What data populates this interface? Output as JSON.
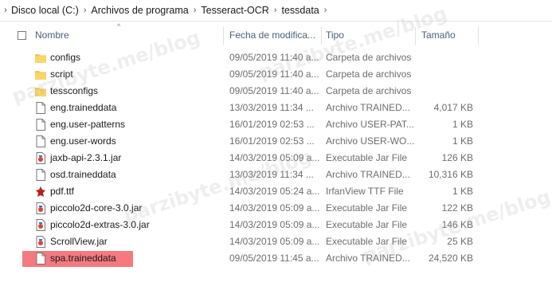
{
  "breadcrumb": {
    "items": [
      "Disco local (C:)",
      "Archivos de programa",
      "Tesseract-OCR",
      "tessdata"
    ]
  },
  "columns": {
    "name": "Nombre",
    "date": "Fecha de modifica...",
    "type": "Tipo",
    "size": "Tamaño"
  },
  "files": [
    {
      "name": "configs",
      "date": "09/05/2019 11:40 a...",
      "type": "Carpeta de archivos",
      "size": "",
      "icon": "folder-icon"
    },
    {
      "name": "script",
      "date": "09/05/2019 11:40 a...",
      "type": "Carpeta de archivos",
      "size": "",
      "icon": "folder-icon"
    },
    {
      "name": "tessconfigs",
      "date": "09/05/2019 11:40 a...",
      "type": "Carpeta de archivos",
      "size": "",
      "icon": "folder-icon"
    },
    {
      "name": "eng.traineddata",
      "date": "13/03/2019 11:34 ...",
      "type": "Archivo TRAINED...",
      "size": "4,017 KB",
      "icon": "file-icon"
    },
    {
      "name": "eng.user-patterns",
      "date": "16/01/2019 02:53 ...",
      "type": "Archivo USER-PAT...",
      "size": "1 KB",
      "icon": "file-icon"
    },
    {
      "name": "eng.user-words",
      "date": "16/01/2019 02:53 ...",
      "type": "Archivo USER-WO...",
      "size": "1 KB",
      "icon": "file-icon"
    },
    {
      "name": "jaxb-api-2.3.1.jar",
      "date": "14/03/2019 05:09 a...",
      "type": "Executable Jar File",
      "size": "126 KB",
      "icon": "jar-file-icon"
    },
    {
      "name": "osd.traineddata",
      "date": "13/03/2019 11:34 ...",
      "type": "Archivo TRAINED...",
      "size": "10,316 KB",
      "icon": "file-icon"
    },
    {
      "name": "pdf.ttf",
      "date": "14/03/2019 05:24 a...",
      "type": "IrfanView TTF File",
      "size": "1 KB",
      "icon": "irfanview-icon"
    },
    {
      "name": "piccolo2d-core-3.0.jar",
      "date": "14/03/2019 05:09 a...",
      "type": "Executable Jar File",
      "size": "122 KB",
      "icon": "jar-file-icon"
    },
    {
      "name": "piccolo2d-extras-3.0.jar",
      "date": "14/03/2019 05:09 a...",
      "type": "Executable Jar File",
      "size": "146 KB",
      "icon": "jar-file-icon"
    },
    {
      "name": "ScrollView.jar",
      "date": "14/03/2019 05:09 a...",
      "type": "Executable Jar File",
      "size": "25 KB",
      "icon": "jar-file-icon"
    },
    {
      "name": "spa.traineddata",
      "date": "09/05/2019 11:45 a...",
      "type": "Archivo TRAINED...",
      "size": "24,520 KB",
      "icon": "file-icon",
      "highlighted": true
    }
  ],
  "watermark": "parzibyte.me/blog",
  "colors": {
    "highlight": "#f47a7f",
    "header_text": "#4c607a",
    "folder": "#f2c64f"
  }
}
